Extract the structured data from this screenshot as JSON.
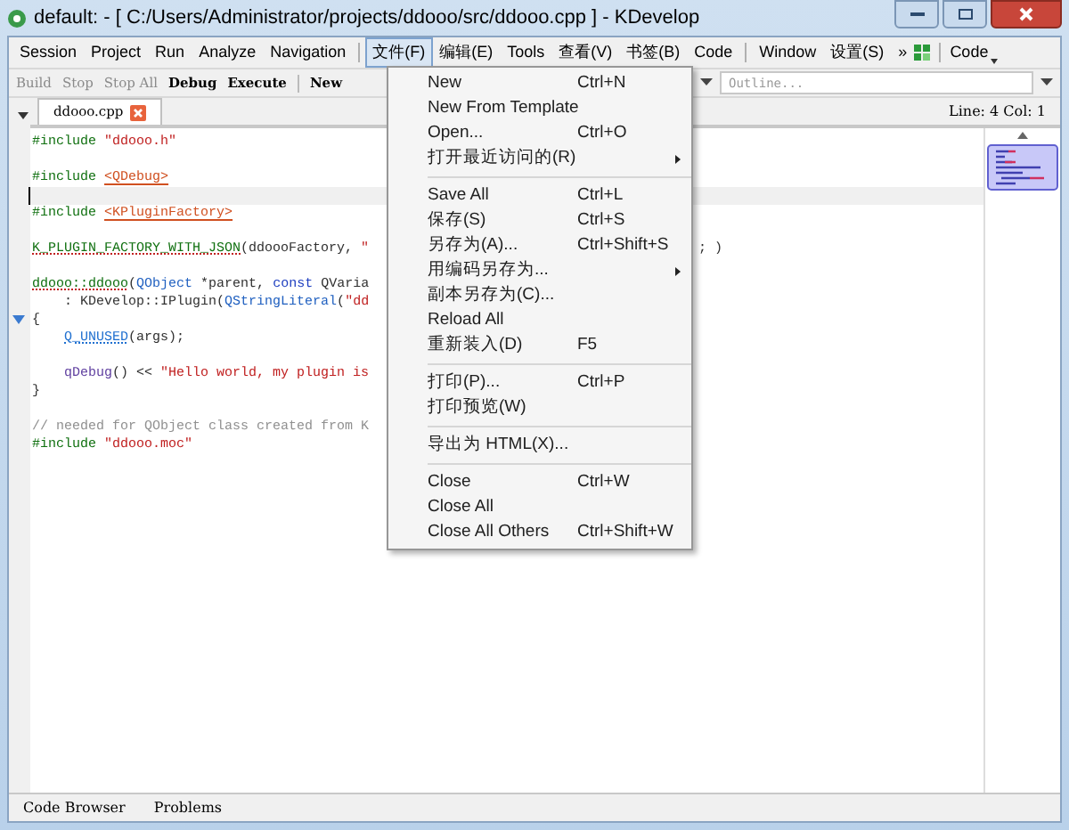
{
  "window": {
    "title": "default:  - [ C:/Users/Administrator/projects/ddooo/src/ddooo.cpp ] - KDevelop"
  },
  "menubar": [
    {
      "kind": "menu",
      "label": "Session",
      "selected": false
    },
    {
      "kind": "menu",
      "label": "Project",
      "selected": false
    },
    {
      "kind": "menu",
      "label": "Run",
      "selected": false
    },
    {
      "kind": "menu",
      "label": "Analyze",
      "selected": false
    },
    {
      "kind": "menu",
      "label": "Navigation",
      "selected": false
    },
    {
      "kind": "separator"
    },
    {
      "kind": "menu",
      "label": "文件(F)",
      "selected": true
    },
    {
      "kind": "menu",
      "label": "编辑(E)",
      "selected": false
    },
    {
      "kind": "menu",
      "label": "Tools",
      "selected": false
    },
    {
      "kind": "menu",
      "label": "查看(V)",
      "selected": false
    },
    {
      "kind": "menu",
      "label": "书签(B)",
      "selected": false
    },
    {
      "kind": "menu",
      "label": "Code",
      "selected": false
    },
    {
      "kind": "separator"
    },
    {
      "kind": "menu",
      "label": "Window",
      "selected": false
    },
    {
      "kind": "menu",
      "label": "设置(S)",
      "selected": false
    },
    {
      "kind": "menu",
      "label": "»",
      "selected": false
    }
  ],
  "menubar_right": {
    "label": "Code"
  },
  "toolbar": [
    {
      "label": "Build",
      "disabled": true
    },
    {
      "label": "Stop",
      "disabled": true
    },
    {
      "label": "Stop All",
      "disabled": true
    },
    {
      "label": "Debug",
      "disabled": false
    },
    {
      "label": "Execute",
      "disabled": false
    },
    {
      "label": "New",
      "disabled": false
    }
  ],
  "outline": {
    "placeholder": "Outline..."
  },
  "tabs": [
    {
      "label": "ddooo.cpp",
      "selected": true
    }
  ],
  "cursor_position": "Line: 4 Col: 1",
  "editor_lines": [
    {
      "current": false,
      "tokens": [
        {
          "kind": "pre",
          "text": "#include "
        },
        {
          "kind": "str",
          "text": "\"ddooo.h\""
        }
      ]
    },
    {
      "current": false
    },
    {
      "current": false,
      "tokens": [
        {
          "kind": "pre",
          "text": "#include "
        },
        {
          "kind": "inc",
          "text": "<QDebug>"
        }
      ]
    },
    {
      "current": true
    },
    {
      "current": false,
      "tokens": [
        {
          "kind": "pre",
          "text": "#include "
        },
        {
          "kind": "inc",
          "text": "<KPluginFactory>"
        }
      ]
    },
    {
      "current": false
    },
    {
      "current": false,
      "tokens": [
        {
          "kind": "macro",
          "text": "K_PLUGIN_FACTORY_WITH_JSON"
        },
        {
          "kind": "plain",
          "text": "(ddoooFactory, "
        },
        {
          "kind": "str",
          "text": "\""
        }
      ],
      "tail": "; )"
    },
    {
      "current": false
    },
    {
      "current": false,
      "tokens": [
        {
          "kind": "fn",
          "text": "ddooo::ddooo"
        },
        {
          "kind": "plain",
          "text": "("
        },
        {
          "kind": "type",
          "text": "QObject"
        },
        {
          "kind": "plain",
          "text": " *parent, "
        },
        {
          "kind": "kw",
          "text": "const"
        },
        {
          "kind": "plain",
          "text": " QVaria"
        }
      ]
    },
    {
      "current": false,
      "tokens": [
        {
          "kind": "plain",
          "text": "    : KDevelop::IPlugin("
        },
        {
          "kind": "type",
          "text": "QStringLiteral"
        },
        {
          "kind": "plain",
          "text": "("
        },
        {
          "kind": "str",
          "text": "\"dd"
        }
      ]
    },
    {
      "current": false,
      "tokens": [
        {
          "kind": "plain",
          "text": "{"
        }
      ],
      "fold": true
    },
    {
      "current": false,
      "indent": true,
      "tokens": [
        {
          "kind": "macro2",
          "text": "Q_UNUSED"
        },
        {
          "kind": "plain",
          "text": "(args);"
        }
      ]
    },
    {
      "current": false
    },
    {
      "current": false,
      "indent": true,
      "tokens": [
        {
          "kind": "fn2",
          "text": "qDebug"
        },
        {
          "kind": "plain",
          "text": "() << "
        },
        {
          "kind": "str",
          "text": "\"Hello world, my plugin is"
        }
      ]
    },
    {
      "current": false,
      "tokens": [
        {
          "kind": "plain",
          "text": "}"
        }
      ]
    },
    {
      "current": false
    },
    {
      "current": false,
      "tokens": [
        {
          "kind": "comment",
          "text": "// needed for QObject class created from K"
        }
      ]
    },
    {
      "current": false,
      "tokens": [
        {
          "kind": "pre",
          "text": "#include "
        },
        {
          "kind": "str",
          "text": "\"ddooo.moc\""
        }
      ]
    }
  ],
  "file_menu": [
    {
      "kind": "item",
      "label": "New",
      "shortcut": "Ctrl+N"
    },
    {
      "kind": "item",
      "label": "New From Template"
    },
    {
      "kind": "item",
      "label": "Open...",
      "shortcut": "Ctrl+O"
    },
    {
      "kind": "submenu",
      "label": "打开最近访问的(R)"
    },
    {
      "kind": "separator"
    },
    {
      "kind": "item",
      "label": "Save All",
      "shortcut": "Ctrl+L"
    },
    {
      "kind": "item",
      "label": "保存(S)",
      "shortcut": "Ctrl+S"
    },
    {
      "kind": "item",
      "label": "另存为(A)...",
      "shortcut": "Ctrl+Shift+S"
    },
    {
      "kind": "submenu",
      "label": "用编码另存为..."
    },
    {
      "kind": "item",
      "label": "副本另存为(C)..."
    },
    {
      "kind": "item",
      "label": "Reload All"
    },
    {
      "kind": "item",
      "label": "重新装入(D)",
      "shortcut": "F5"
    },
    {
      "kind": "separator"
    },
    {
      "kind": "item",
      "label": "打印(P)...",
      "shortcut": "Ctrl+P"
    },
    {
      "kind": "item",
      "label": "打印预览(W)"
    },
    {
      "kind": "separator"
    },
    {
      "kind": "item",
      "label": "导出为 HTML(X)..."
    },
    {
      "kind": "separator"
    },
    {
      "kind": "item",
      "label": "Close",
      "shortcut": "Ctrl+W"
    },
    {
      "kind": "item",
      "label": "Close All"
    },
    {
      "kind": "item",
      "label": "Close All Others",
      "shortcut": "Ctrl+Shift+W"
    }
  ],
  "bottom_tabs": [
    {
      "label": "Code Browser"
    },
    {
      "label": "Problems"
    }
  ]
}
